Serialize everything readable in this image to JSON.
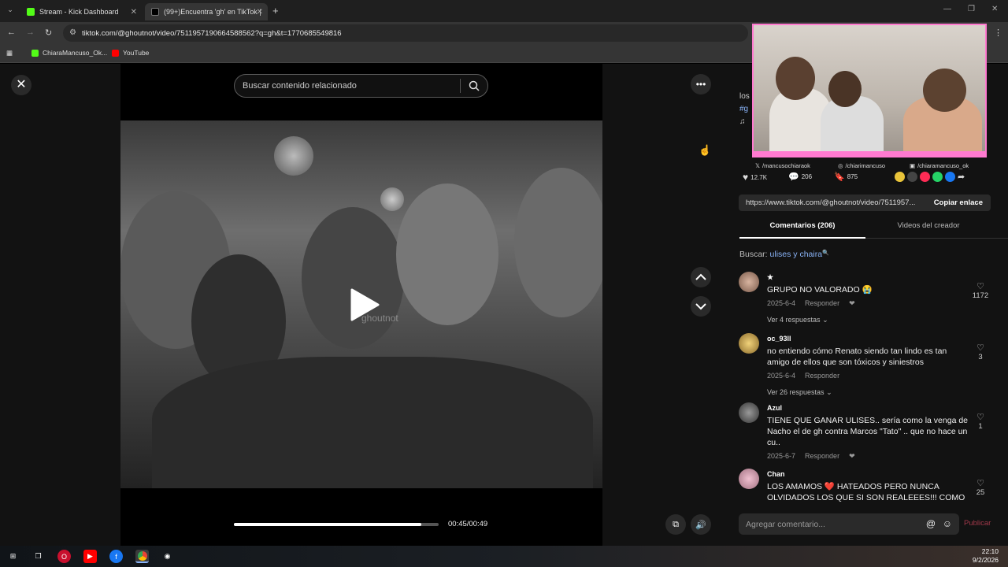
{
  "browser": {
    "tabs": [
      {
        "title": "Stream - Kick Dashboard",
        "active": false
      },
      {
        "title": "(99+)Encuentra 'gh' en TikTok |",
        "active": true
      }
    ],
    "url": "tiktok.com/@ghoutnot/video/7511957190664588562?q=gh&t=1770685549816",
    "bookmarks": [
      {
        "label": "ChiaraMancuso_Ok..."
      },
      {
        "label": "YouTube"
      }
    ]
  },
  "player": {
    "search_placeholder": "Buscar contenido relacionado",
    "watermark": "ghoutnot",
    "time": "00:45/00:49",
    "progress_fraction": 0.917
  },
  "panel": {
    "creator_line1": "los",
    "creator_tag": "#g",
    "actions": {
      "likes": "12.7K",
      "comments": "206",
      "saves": "875",
      "overlay_handles": [
        "/mancusochiaraok",
        "/chiarimancuso",
        "/chiaramancuso_ok"
      ]
    },
    "share_link": "https://www.tiktok.com/@ghoutnot/video/7511957...",
    "copy_link_label": "Copiar enlace",
    "tab_comments": "Comentarios (206)",
    "tab_videos": "Videos del creador",
    "search_label": "Buscar:",
    "search_query": "ulises y chaira",
    "comments": [
      {
        "user": "★",
        "text": "GRUPO NO VALORADO 😭",
        "date": "2025-6-4",
        "reply_label": "Responder",
        "replies": "Ver 4 respuestas",
        "likes": "1172"
      },
      {
        "user": "oc_93ll",
        "text": "no entiendo cómo Renato siendo tan lindo es tan amigo de ellos que son tóxicos y siniestros",
        "date": "2025-6-4",
        "reply_label": "Responder",
        "replies": "Ver 26 respuestas",
        "likes": "3"
      },
      {
        "user": "Azul",
        "text": "TIENE QUE GANAR ULISES.. sería como la venga de Nacho el de gh contra Marcos \"Tato\" .. que no hace un cu..",
        "date": "2025-6-7",
        "reply_label": "Responder",
        "replies": "",
        "likes": "1"
      },
      {
        "user": "Chan",
        "text": "LOS AMAMOS ❤️ HATEADOS PERO NUNCA OLVIDADOS LOS QUE SI SON REALEEES!!! COMO",
        "date": "",
        "reply_label": "",
        "replies": "",
        "likes": "25"
      }
    ],
    "comment_placeholder": "Agregar comentario...",
    "publish_label": "Publicar"
  },
  "taskbar": {
    "time": "22:10",
    "date": "9/2/2026"
  },
  "colors": {
    "kick_green": "#53fc18",
    "link_blue": "#8ab4f8",
    "overlay_pink": "#ff7ad0",
    "publish_red": "#a0384a"
  }
}
